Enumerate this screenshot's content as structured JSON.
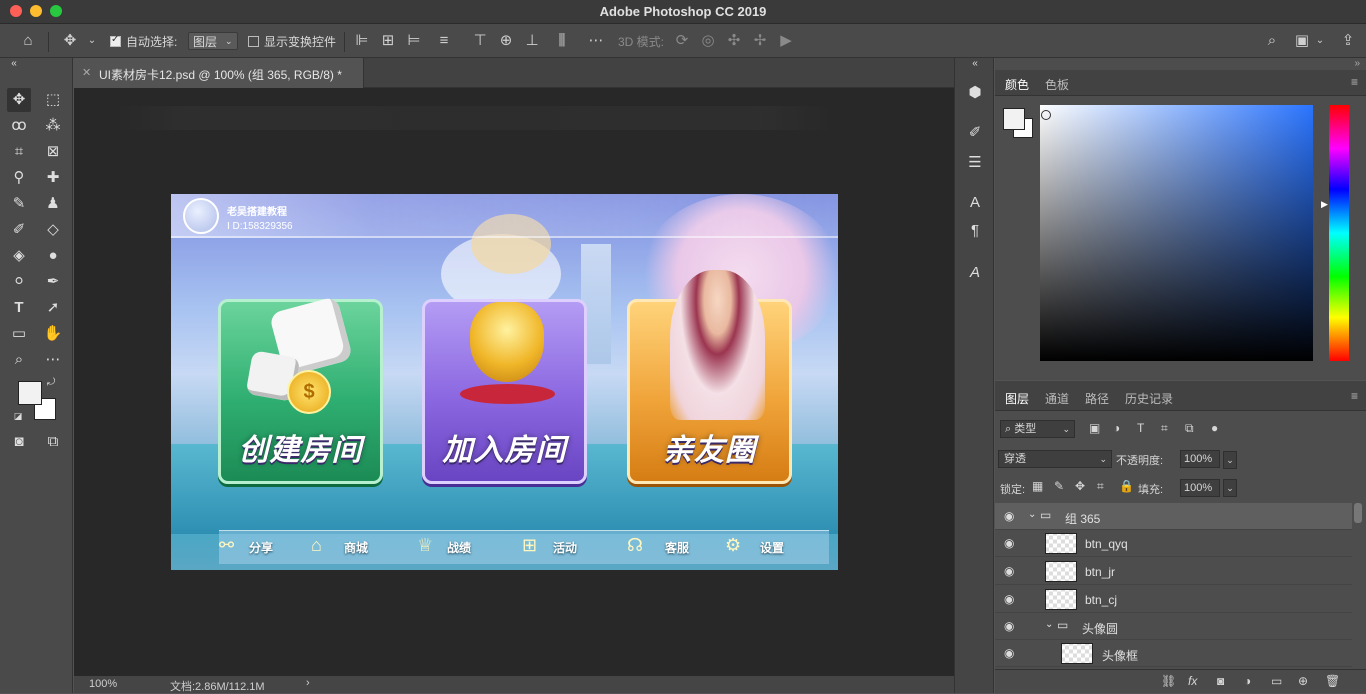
{
  "window": {
    "title": "Adobe Photoshop CC 2019"
  },
  "options_bar": {
    "auto_select_label": "自动选择:",
    "auto_select_value": "图层",
    "show_transform_label": "显示变换控件",
    "mode_3d_label": "3D 模式:"
  },
  "document_tab": {
    "label": "UI素材房卡12.psd @ 100% (组 365, RGB/8) *"
  },
  "status_bar": {
    "zoom": "100%",
    "doc_info": "文档:2.86M/112.1M"
  },
  "artwork": {
    "username": "老吴搭建教程",
    "user_id": "I D:158329356",
    "cards": [
      {
        "label": "创建房间"
      },
      {
        "label": "加入房间"
      },
      {
        "label": "亲友圈"
      }
    ],
    "bottom_nav": [
      {
        "label": "分享",
        "icon": "share-icon"
      },
      {
        "label": "商城",
        "icon": "shop-icon"
      },
      {
        "label": "战绩",
        "icon": "trophy-icon"
      },
      {
        "label": "活动",
        "icon": "gift-icon"
      },
      {
        "label": "客服",
        "icon": "headset-icon"
      },
      {
        "label": "设置",
        "icon": "gear-icon"
      }
    ]
  },
  "color_panel": {
    "tabs": [
      "颜色",
      "色板"
    ]
  },
  "layers_panel": {
    "tabs": [
      "图层",
      "通道",
      "路径",
      "历史记录"
    ],
    "filter_kind": "类型",
    "blend_mode": "穿透",
    "opacity_label": "不透明度:",
    "opacity_value": "100%",
    "lock_label": "锁定:",
    "fill_label": "填充:",
    "fill_value": "100%",
    "layers": [
      {
        "name": "组 365",
        "type": "group"
      },
      {
        "name": "btn_qyq",
        "type": "layer"
      },
      {
        "name": "btn_jr",
        "type": "layer"
      },
      {
        "name": "btn_cj",
        "type": "layer"
      },
      {
        "name": "头像圆",
        "type": "group"
      },
      {
        "name": "头像框",
        "type": "layer"
      }
    ]
  }
}
